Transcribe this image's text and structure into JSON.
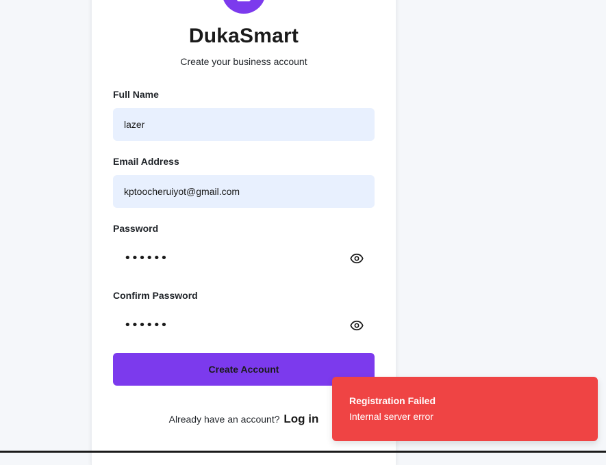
{
  "brand": {
    "name": "DukaSmart",
    "subtitle": "Create your business account",
    "logo_icon": "store-icon",
    "accent_color": "#7c3aed"
  },
  "form": {
    "full_name": {
      "label": "Full Name",
      "value": "lazer"
    },
    "email": {
      "label": "Email Address",
      "value": "kptoocheruiyot@gmail.com"
    },
    "password": {
      "label": "Password",
      "value": "••••••",
      "toggle_icon": "eye-icon"
    },
    "confirm_password": {
      "label": "Confirm Password",
      "value": "••••••",
      "toggle_icon": "eye-icon"
    },
    "submit_label": "Create Account"
  },
  "footer": {
    "prompt": "Already have an account?",
    "login_label": "Log in"
  },
  "toast": {
    "title": "Registration Failed",
    "message": "Internal server error",
    "color": "#ef4444"
  }
}
